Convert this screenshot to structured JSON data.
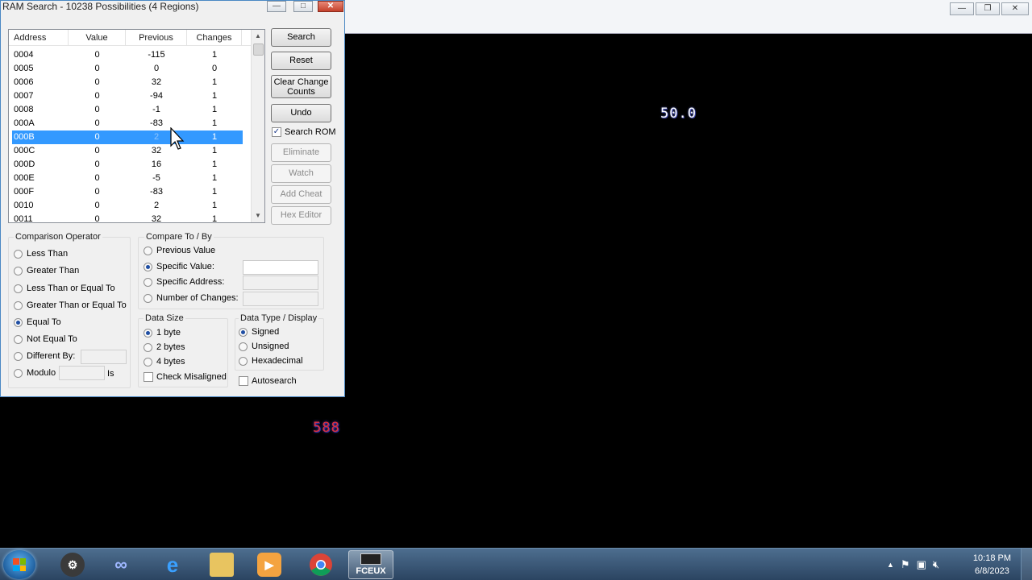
{
  "dialog": {
    "title": "RAM Search - 10238 Possibilities (4 Regions)",
    "min_label": "—",
    "max_label": "□",
    "close_label": "✕"
  },
  "list": {
    "headers": [
      "Address",
      "Value",
      "Previous",
      "Changes"
    ],
    "rows": [
      {
        "address": "0004",
        "value": "0",
        "previous": "-115",
        "changes": "1"
      },
      {
        "address": "0005",
        "value": "0",
        "previous": "0",
        "changes": "0"
      },
      {
        "address": "0006",
        "value": "0",
        "previous": "32",
        "changes": "1"
      },
      {
        "address": "0007",
        "value": "0",
        "previous": "-94",
        "changes": "1"
      },
      {
        "address": "0008",
        "value": "0",
        "previous": "-1",
        "changes": "1"
      },
      {
        "address": "000A",
        "value": "0",
        "previous": "-83",
        "changes": "1"
      },
      {
        "address": "000B",
        "value": "0",
        "previous": "2",
        "changes": "1"
      },
      {
        "address": "000C",
        "value": "0",
        "previous": "32",
        "changes": "1"
      },
      {
        "address": "000D",
        "value": "0",
        "previous": "16",
        "changes": "1"
      },
      {
        "address": "000E",
        "value": "0",
        "previous": "-5",
        "changes": "1"
      },
      {
        "address": "000F",
        "value": "0",
        "previous": "-83",
        "changes": "1"
      },
      {
        "address": "0010",
        "value": "0",
        "previous": "2",
        "changes": "1"
      },
      {
        "address": "0011",
        "value": "0",
        "previous": "32",
        "changes": "1"
      }
    ],
    "selected_address": "000B"
  },
  "buttons": {
    "search": "Search",
    "reset": "Reset",
    "clear_change_1": "Clear Change",
    "clear_change_2": "Counts",
    "undo": "Undo",
    "search_rom": "Search ROM",
    "eliminate": "Eliminate",
    "watch": "Watch",
    "add_cheat": "Add Cheat",
    "hex_editor": "Hex Editor"
  },
  "comparison": {
    "label": "Comparison Operator",
    "less_than": "Less Than",
    "greater_than": "Greater Than",
    "less_equal": "Less Than or Equal To",
    "greater_equal": "Greater Than or Equal To",
    "equal": "Equal To",
    "not_equal": "Not Equal To",
    "different_by": "Different By:",
    "modulo": "Modulo",
    "is_label": "Is",
    "selected": "Equal To"
  },
  "compare_to": {
    "label": "Compare To / By",
    "previous_value": "Previous Value",
    "specific_value": "Specific Value:",
    "specific_address": "Specific Address:",
    "number_changes": "Number of Changes:",
    "selected": "Specific Value:"
  },
  "data_size": {
    "label": "Data Size",
    "one_byte": "1 byte",
    "two_bytes": "2 bytes",
    "four_bytes": "4 bytes",
    "check_misaligned": "Check Misaligned",
    "selected": "1 byte"
  },
  "data_type": {
    "label": "Data Type / Display",
    "signed": "Signed",
    "unsigned": "Unsigned",
    "hexadecimal": "Hexadecimal",
    "autosearch": "Autosearch",
    "selected": "Signed"
  },
  "game": {
    "top_number": "50.0",
    "bottom_number": "588"
  },
  "taskbar": {
    "time": "10:18 PM",
    "date": "6/8/2023",
    "active_app_label": "FCEUX"
  }
}
